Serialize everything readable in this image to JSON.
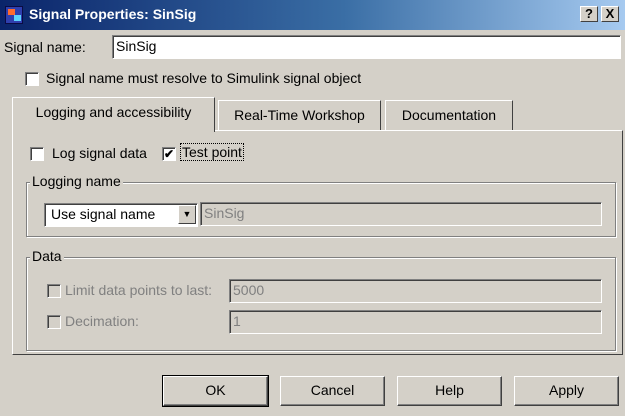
{
  "window": {
    "title": "Signal Properties: SinSig",
    "help_label": "?",
    "close_label": "X"
  },
  "signal_name": {
    "label": "Signal name:",
    "value": "SinSig"
  },
  "resolve_checkbox": {
    "label": "Signal name must resolve to Simulink signal object",
    "checked": false
  },
  "tabs": [
    {
      "label": "Logging and accessibility",
      "active": true
    },
    {
      "label": "Real-Time Workshop",
      "active": false
    },
    {
      "label": "Documentation",
      "active": false
    }
  ],
  "logging_tab": {
    "log_signal_data": {
      "label": "Log signal data",
      "checked": false
    },
    "test_point": {
      "label": "Test point",
      "checked": true,
      "mark": "✔"
    },
    "logging_name_group": {
      "title": "Logging name",
      "dropdown_value": "Use signal name",
      "name_value": "SinSig"
    },
    "data_group": {
      "title": "Data",
      "limit_points": {
        "label": "Limit data points to last:",
        "checked": false,
        "value": "5000",
        "enabled": false
      },
      "decimation": {
        "label": "Decimation:",
        "checked": false,
        "value": "1",
        "enabled": false
      }
    }
  },
  "buttons": {
    "ok": "OK",
    "cancel": "Cancel",
    "help": "Help",
    "apply": "Apply"
  },
  "colors": {
    "dialog_bg": "#d4d0c8",
    "titlebar_start": "#0a246a",
    "titlebar_end": "#a6caf0",
    "disabled_text": "#808080"
  }
}
